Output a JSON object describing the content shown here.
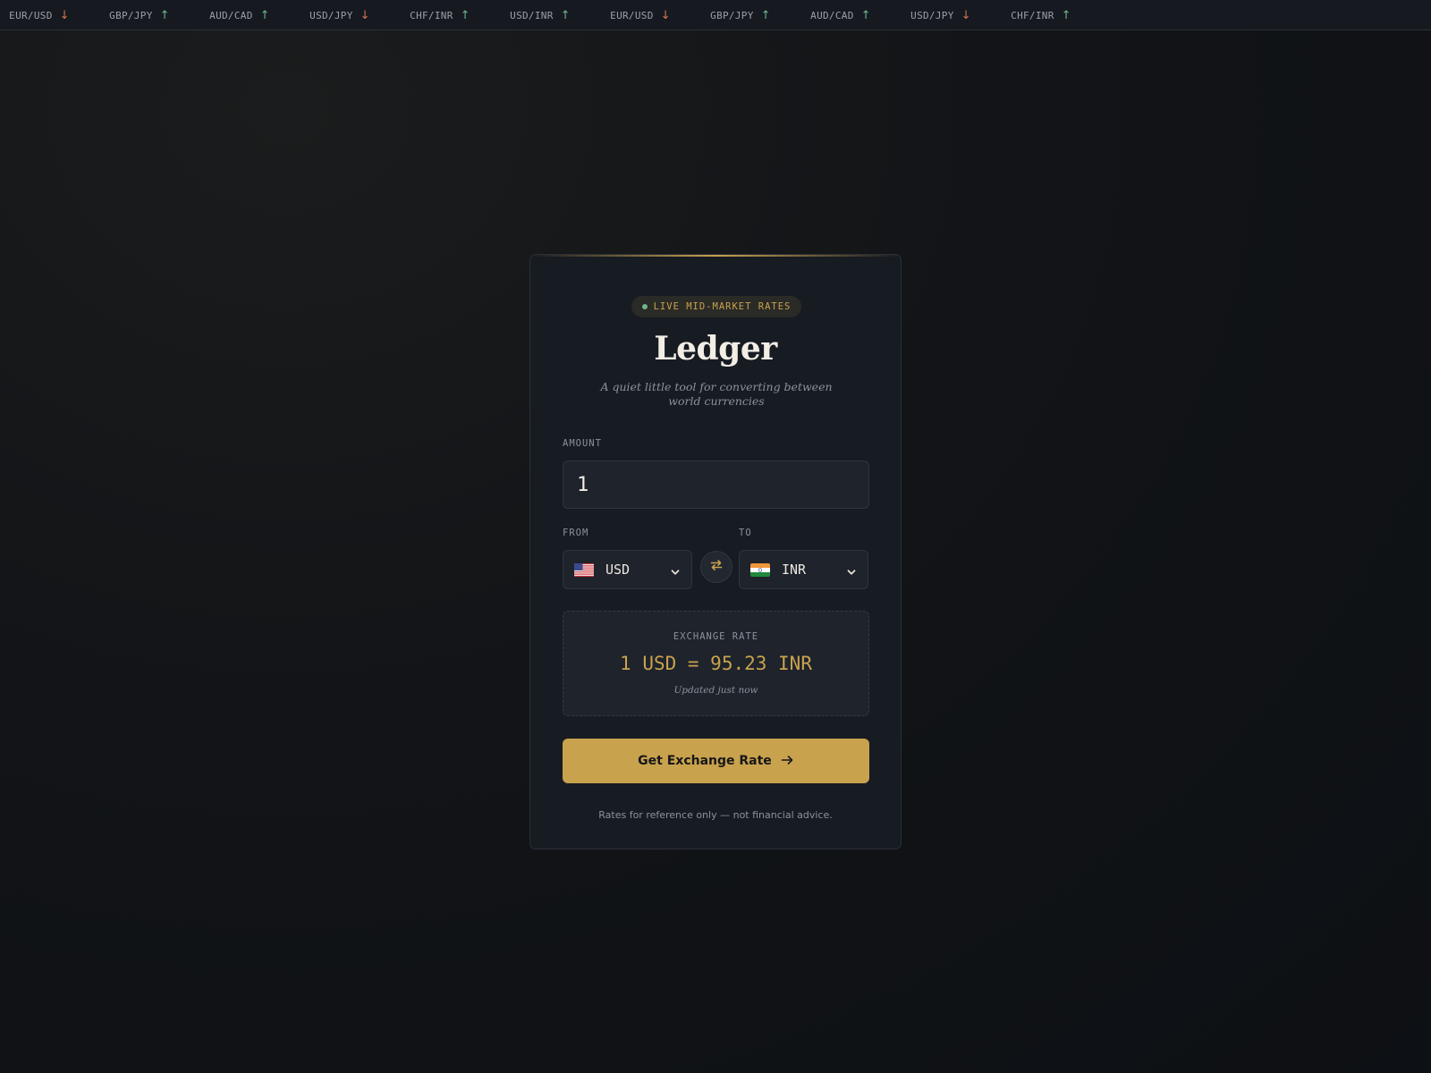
{
  "ticker": {
    "items": [
      {
        "pair": "EUR/USD",
        "direction": "down"
      },
      {
        "pair": "GBP/JPY",
        "direction": "up"
      },
      {
        "pair": "AUD/CAD",
        "direction": "up"
      },
      {
        "pair": "USD/JPY",
        "direction": "down"
      },
      {
        "pair": "CHF/INR",
        "direction": "up"
      },
      {
        "pair": "USD/INR",
        "direction": "up"
      },
      {
        "pair": "EUR/USD",
        "direction": "down"
      },
      {
        "pair": "GBP/JPY",
        "direction": "up"
      },
      {
        "pair": "AUD/CAD",
        "direction": "up"
      },
      {
        "pair": "USD/JPY",
        "direction": "down"
      },
      {
        "pair": "CHF/INR",
        "direction": "up"
      }
    ],
    "up_symbol": "↑",
    "down_symbol": "↓",
    "up_color": "#6fb48a",
    "down_color": "#d8734f"
  },
  "card": {
    "badge": "LIVE MID-MARKET RATES",
    "title": "Ledger",
    "subtitle": "A quiet little tool for converting between world currencies",
    "amount_label": "AMOUNT",
    "amount_value": "1",
    "from_label": "FROM",
    "to_label": "TO",
    "from_currency": "USD",
    "to_currency": "INR",
    "rate_label": "EXCHANGE RATE",
    "rate_value": "1 USD = 95.23 INR",
    "rate_updated": "Updated just now",
    "cta_label": "Get Exchange Rate",
    "disclaimer": "Rates for reference only — not financial advice."
  },
  "colors": {
    "accent": "#c9a24e",
    "live": "#6fb48a",
    "card_bg": "#171b22"
  }
}
